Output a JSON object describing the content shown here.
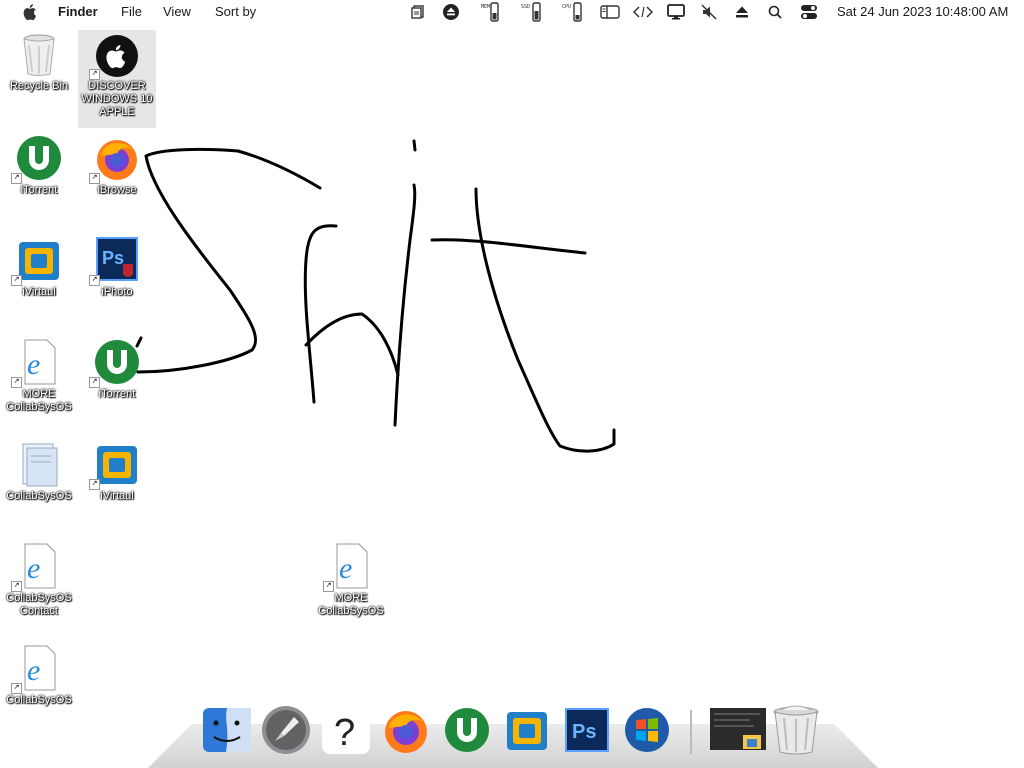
{
  "menubar": {
    "app_name": "Finder",
    "menus": [
      "File",
      "View",
      "Sort by"
    ],
    "status_icons": [
      "files-icon",
      "eject-circle-icon",
      "mem-gauge-icon",
      "ssd-gauge-icon",
      "cpu-gauge-icon",
      "sidebar-icon",
      "code-icon",
      "display-icon",
      "mute-icon",
      "eject-icon",
      "search-icon",
      "control-center-icon"
    ],
    "status_labels": {
      "mem": "MEM",
      "ssd": "SSD",
      "cpu": "CPU"
    },
    "clock": "Sat 24 Jun 2023 10:48:00 AM"
  },
  "desktop": {
    "icons": [
      {
        "label": "Recycle Bin",
        "icon": "recycle-bin-icon"
      },
      {
        "label": "DISCOVER WINDOWS 10 APPLE",
        "icon": "apple-logo-icon"
      },
      {
        "label": "iTorrent",
        "icon": "utorrent-icon"
      },
      {
        "label": "iBrowse",
        "icon": "firefox-icon"
      },
      {
        "label": "iVirtaul",
        "icon": "virtualbox-icon"
      },
      {
        "label": "iPhoto",
        "icon": "photoshop-icon"
      },
      {
        "label": "MORE CollabSysOS",
        "icon": "ie-file-icon"
      },
      {
        "label": "iTorrent",
        "icon": "utorrent-icon"
      },
      {
        "label": "CollabSysOS",
        "icon": "folder-icon"
      },
      {
        "label": "iVirtaul",
        "icon": "virtualbox-icon"
      },
      {
        "label": "CollabSysOS Contact",
        "icon": "ie-file-icon"
      },
      {
        "label": "MORE CollabSysOS",
        "icon": "ie-file-icon"
      },
      {
        "label": "CollabSysOS",
        "icon": "ie-file-icon"
      }
    ]
  },
  "dock": {
    "items": [
      "finder-icon",
      "launchpad-icon",
      "help-icon",
      "firefox-icon",
      "utorrent-icon",
      "virtualbox-icon",
      "photoshop-icon",
      "windows-icon",
      "window-thumbnail-icon",
      "trash-icon"
    ]
  },
  "colors": {
    "background": "#ffffff",
    "drawing_stroke": "#000000",
    "utorrent_green": "#1f8a3c",
    "photoshop_blue": "#0b2a5a"
  }
}
